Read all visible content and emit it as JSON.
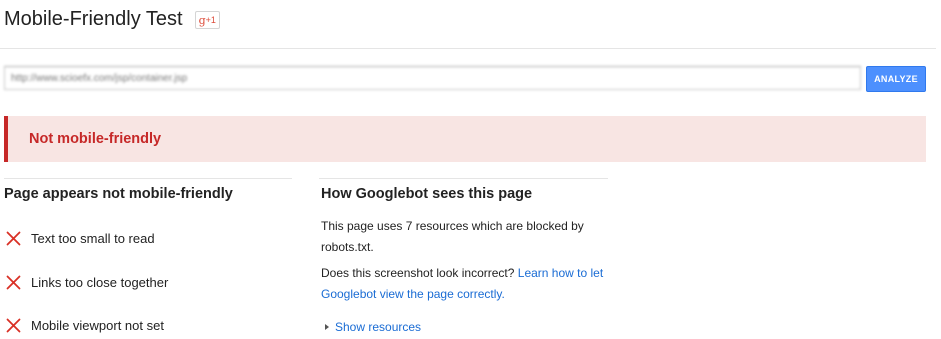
{
  "header": {
    "title": "Mobile-Friendly Test",
    "gplus_label": "g",
    "gplus_plus": "+1"
  },
  "search": {
    "url_value": "http://www.scioefx.com/jsp/container.jsp",
    "analyze_label": "ANALYZE"
  },
  "result": {
    "banner_text": "Not mobile-friendly"
  },
  "left_panel": {
    "heading": "Page appears not mobile-friendly",
    "issues": [
      {
        "label": "Text too small to read",
        "icon": "red-x-icon"
      },
      {
        "label": "Links too close together",
        "icon": "red-x-icon"
      },
      {
        "label": "Mobile viewport not set",
        "icon": "red-x-icon"
      }
    ]
  },
  "right_panel": {
    "heading": "How Googlebot sees this page",
    "blocked_text": "This page uses 7 resources which are blocked by robots.txt.",
    "question_text": "Does this screenshot look incorrect? ",
    "learn_link": "Learn how to let Googlebot view the page correctly.",
    "show_resources": "Show resources"
  },
  "colors": {
    "accent_blue": "#4d90fe",
    "error_red": "#c62828",
    "banner_bg": "#f8e5e3",
    "link_blue": "#1a6cd4"
  }
}
